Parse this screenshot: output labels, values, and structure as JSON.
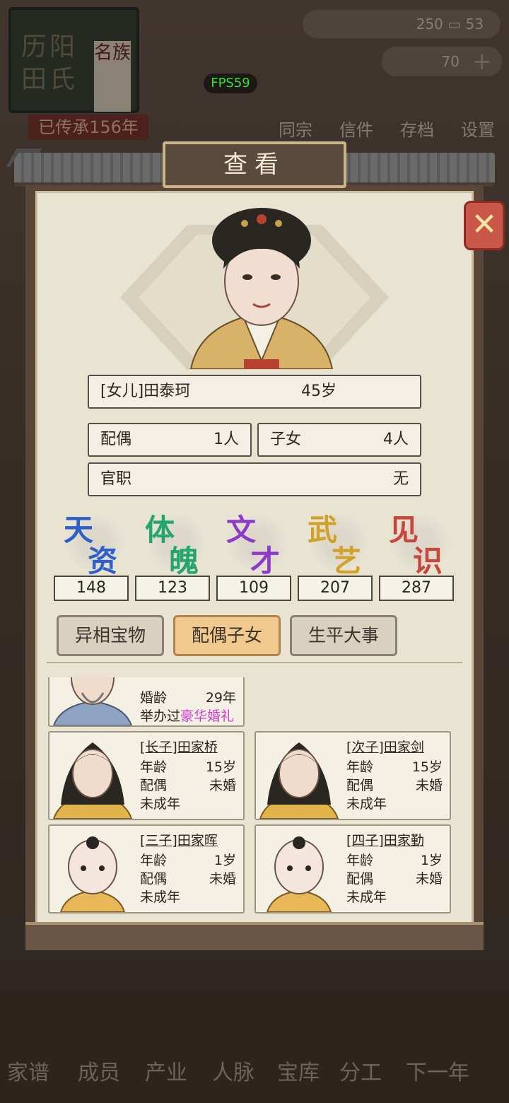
{
  "background": {
    "plaque_surname_chars": "历阳田氏",
    "plaque_tag": "名族",
    "inherit_text": "已传承156年",
    "currency_a": "250",
    "currency_b": "53",
    "gold": "70",
    "top_menu": [
      "同宗",
      "信件",
      "存档",
      "设置"
    ],
    "bottom_menu": [
      "家谱",
      "成员",
      "产业",
      "人脉",
      "宝库",
      "分工",
      "下一年"
    ]
  },
  "fps": "FPS59",
  "dialog": {
    "title": "查看",
    "close_icon": "close-x-icon",
    "person": {
      "relation_name": "[女儿]田泰珂",
      "age": "45岁",
      "spouse_label": "配偶",
      "spouse_value": "1人",
      "children_label": "子女",
      "children_value": "4人",
      "office_label": "官职",
      "office_value": "无"
    },
    "stats": [
      {
        "c1": "天",
        "c2": "资",
        "value": "148",
        "color": "#2f5fc9"
      },
      {
        "c1": "体",
        "c2": "魄",
        "value": "123",
        "color": "#23a56b"
      },
      {
        "c1": "文",
        "c2": "才",
        "value": "109",
        "color": "#8c3ac9"
      },
      {
        "c1": "武",
        "c2": "艺",
        "value": "207",
        "color": "#d1a22a"
      },
      {
        "c1": "见",
        "c2": "识",
        "value": "287",
        "color": "#c8473c"
      }
    ],
    "tabs": [
      "异相宝物",
      "配偶子女",
      "生平大事"
    ],
    "spouse_card": {
      "marriage_age_label": "婚龄",
      "marriage_age_value": "29年",
      "wedding_prefix": "举办过",
      "wedding_highlight": "豪华婚礼"
    },
    "children": [
      {
        "name": "[长子]田家桥",
        "age_label": "年龄",
        "age": "15岁",
        "spouse_label": "配偶",
        "spouse": "未婚",
        "status": "未成年"
      },
      {
        "name": "[次子]田家剑",
        "age_label": "年龄",
        "age": "15岁",
        "spouse_label": "配偶",
        "spouse": "未婚",
        "status": "未成年"
      },
      {
        "name": "[三子]田家晖",
        "age_label": "年龄",
        "age": "1岁",
        "spouse_label": "配偶",
        "spouse": "未婚",
        "status": "未成年"
      },
      {
        "name": "[四子]田家勤",
        "age_label": "年龄",
        "age": "1岁",
        "spouse_label": "配偶",
        "spouse": "未婚",
        "status": "未成年"
      }
    ]
  }
}
